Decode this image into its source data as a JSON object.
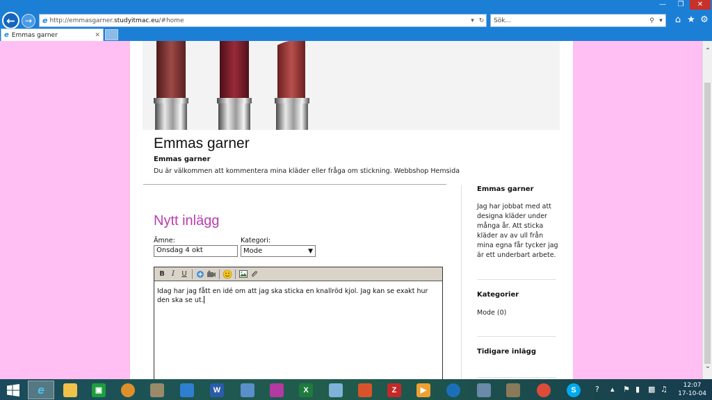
{
  "browser": {
    "url_prefix": "http://emmasgarner.",
    "url_domain": "studyitmac.eu",
    "url_suffix": "/#home",
    "search_placeholder": "Sök...",
    "tab_title": "Emmas garner"
  },
  "blog": {
    "title": "Emmas garner",
    "subtitle": "Emmas garner",
    "description": "Du är välkommen att kommentera mina kläder eller fråga om stickning.",
    "links": [
      "Webbshop",
      "Hemsida"
    ]
  },
  "post_form": {
    "heading": "Nytt inlägg",
    "subject_label": "Ämne:",
    "subject_value": "Onsdag 4 okt",
    "category_label": "Kategori:",
    "category_value": "Mode",
    "toolbar": [
      "B",
      "I",
      "U"
    ],
    "body_text": "Idag har jag fått en idé om att jag ska sticka en knallröd kjol. Jag kan se exakt hur den ska se ut."
  },
  "sidebar": {
    "about_title": "Emmas garner",
    "about_text": "Jag har jobbat med att designa kläder under många år. Att sticka kläder av av ull från mina egna får tycker jag är ett underbart arbete.",
    "categories_title": "Kategorier",
    "categories": [
      "Mode (0)"
    ],
    "previous_title": "Tidigare inlägg"
  },
  "taskbar": {
    "time": "12:07",
    "date": "17-10-04"
  },
  "colors": {
    "page_bg": "#ffbff2",
    "heading_accent": "#b93dae",
    "chrome_blue": "#1c7fd6"
  }
}
